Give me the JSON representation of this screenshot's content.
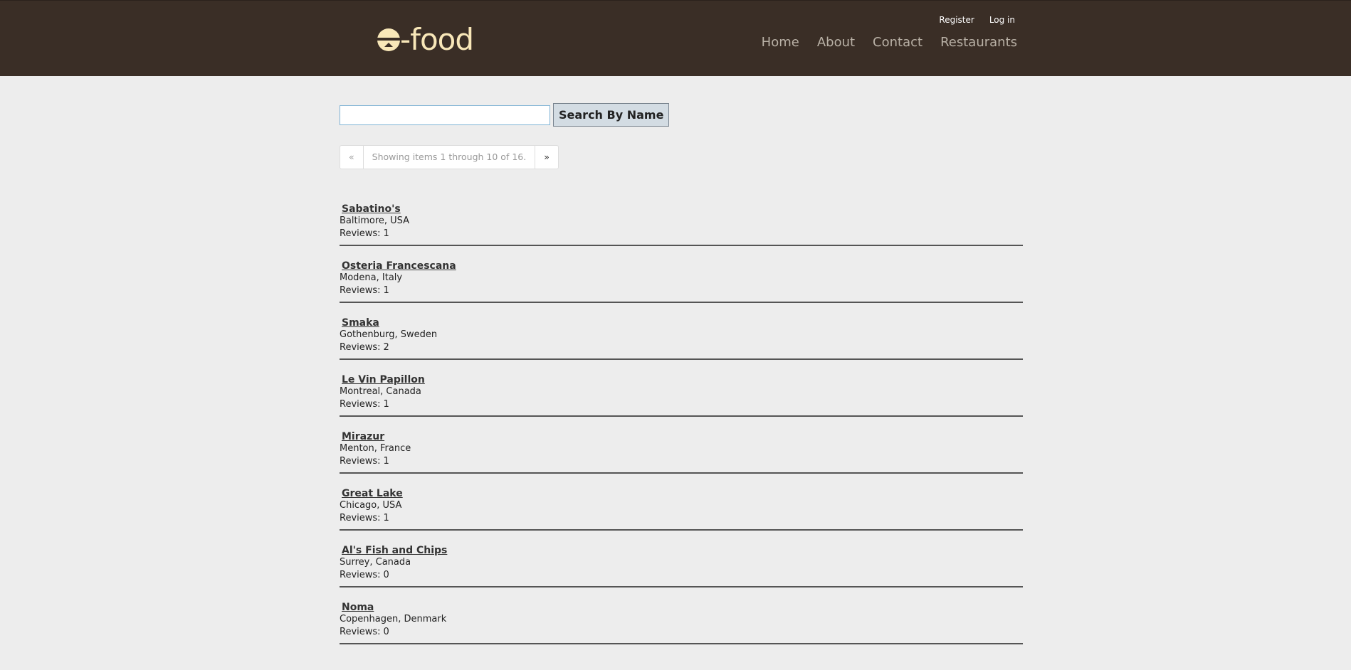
{
  "header": {
    "logo_text": "-food",
    "auth": {
      "register": "Register",
      "login": "Log in"
    },
    "nav": [
      {
        "label": "Home"
      },
      {
        "label": "About"
      },
      {
        "label": "Contact"
      },
      {
        "label": "Restaurants"
      }
    ]
  },
  "search": {
    "value": "",
    "placeholder": "",
    "button_label": "Search By Name"
  },
  "pager": {
    "prev": "«",
    "status": "Showing items 1 through 10 of 16.",
    "next": "»"
  },
  "reviews_label": "Reviews:",
  "restaurants": [
    {
      "name": "Sabatino's",
      "location": "Baltimore, USA",
      "reviews": "1"
    },
    {
      "name": "Osteria Francescana",
      "location": "Modena, Italy",
      "reviews": "1"
    },
    {
      "name": "Smaka",
      "location": "Gothenburg, Sweden",
      "reviews": "2"
    },
    {
      "name": "Le Vin Papillon",
      "location": "Montreal, Canada",
      "reviews": "1"
    },
    {
      "name": "Mirazur",
      "location": "Menton, France",
      "reviews": "1"
    },
    {
      "name": "Great Lake",
      "location": "Chicago, USA",
      "reviews": "1"
    },
    {
      "name": "Al's Fish and Chips",
      "location": "Surrey, Canada",
      "reviews": "0"
    },
    {
      "name": "Noma",
      "location": "Copenhagen, Denmark",
      "reviews": "0"
    }
  ],
  "colors": {
    "header_bg": "#3a2e26",
    "logo": "#f8e7b8",
    "nav_text": "#b9b1a6",
    "page_bg": "#ededed"
  }
}
